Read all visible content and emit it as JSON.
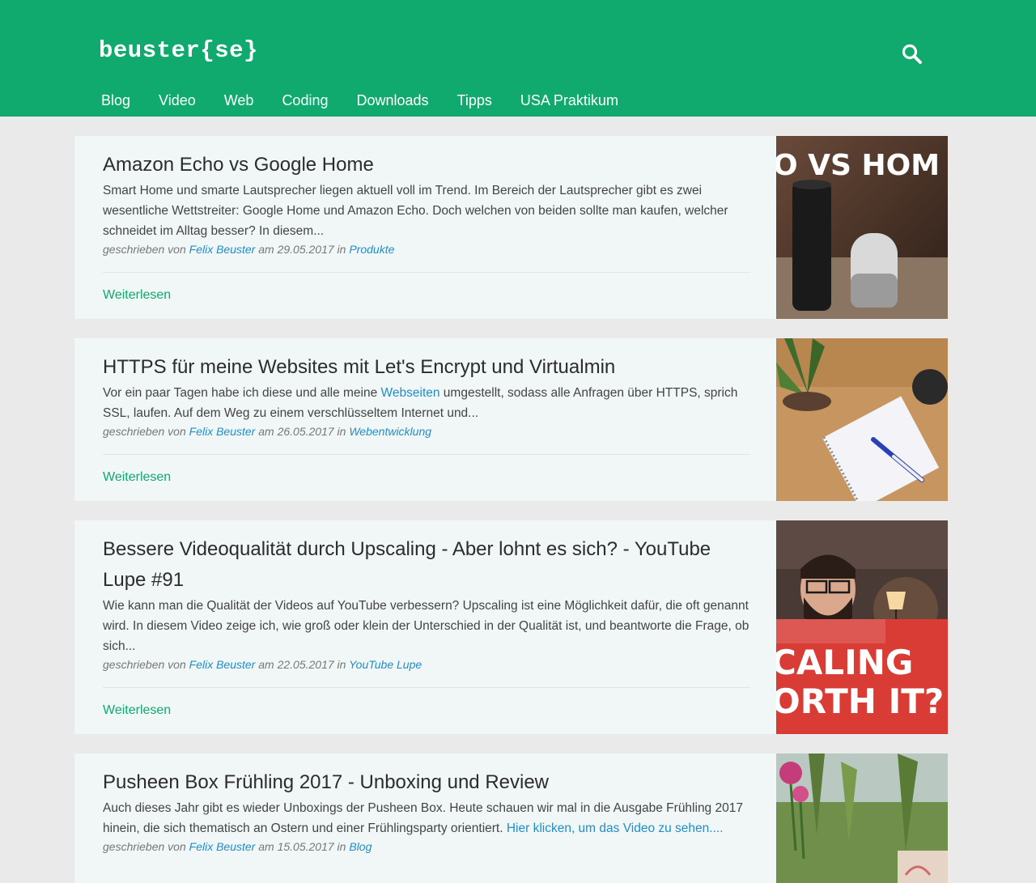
{
  "header": {
    "logo": "beuster{se}",
    "search_icon": "search-icon",
    "nav": [
      "Blog",
      "Video",
      "Web",
      "Coding",
      "Downloads",
      "Tipps",
      "USA Praktikum"
    ]
  },
  "colors": {
    "brand": "#10a96e",
    "link": "#1f8ec9",
    "card_bg": "#f1f6f6",
    "page_bg": "#eaeaea"
  },
  "meta_labels": {
    "written_by": "geschrieben von",
    "on": "am",
    "in": "in"
  },
  "posts": [
    {
      "title": "Amazon Echo vs Google Home",
      "excerpt": "Smart Home und smarte Lautsprecher liegen aktuell voll im Trend. Im Bereich der Lautsprecher gibt es zwei wesentliche Wettstreiter: Google Home und Amazon Echo. Doch welchen von beiden sollte man kaufen, welcher schneidet im Alltag besser? In diesem...",
      "author": "Felix Beuster",
      "date": "29.05.2017",
      "category": "Produkte",
      "read_more": "Weiterlesen",
      "thumb_text": "O VS HOM"
    },
    {
      "title": "HTTPS für meine Websites mit Let's Encrypt und Virtualmin",
      "excerpt_before": "Vor ein paar Tagen habe ich diese und alle meine ",
      "excerpt_link": "Webseiten",
      "excerpt_after": " umgestellt, sodass alle Anfragen über HTTPS, sprich SSL, laufen. Auf dem Weg zu einem verschlüsseltem Internet und...",
      "author": "Felix Beuster",
      "date": "26.05.2017",
      "category": "Webentwicklung",
      "read_more": "Weiterlesen"
    },
    {
      "title": "Bessere Videoqualität durch Upscaling - Aber lohnt es sich? - YouTube Lupe #91",
      "excerpt": "Wie kann man die Qualität der Videos auf YouTube verbessern? Upscaling ist eine Möglichkeit dafür, die oft genannt wird. In diesem Video zeige ich, wie groß oder klein der Unterschied in der Qualität ist, und beantworte die Frage, ob sich...",
      "author": "Felix Beuster",
      "date": "22.05.2017",
      "category": "YouTube Lupe",
      "read_more": "Weiterlesen",
      "thumb_text_1": "CALING",
      "thumb_text_2": "ORTH IT?"
    },
    {
      "title": "Pusheen Box Frühling 2017 - Unboxing und Review",
      "excerpt_before": "Auch dieses Jahr gibt es wieder Unboxings der Pusheen Box. Heute schauen wir mal in die Ausgabe Frühling 2017 hinein, die sich thematisch an Ostern und einer Frühlingsparty orientiert. ",
      "excerpt_link": "Hier klicken, um das Video zu sehen....",
      "author": "Felix Beuster",
      "date": "15.05.2017",
      "category": "Blog"
    }
  ]
}
